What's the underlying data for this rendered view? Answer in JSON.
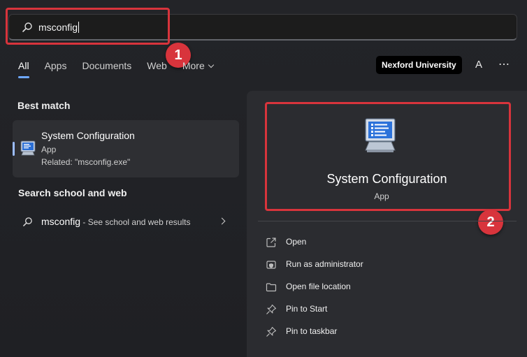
{
  "search": {
    "query": "msconfig"
  },
  "tabs": [
    {
      "label": "All"
    },
    {
      "label": "Apps"
    },
    {
      "label": "Documents"
    },
    {
      "label": "Web"
    },
    {
      "label": "More"
    }
  ],
  "header": {
    "org_label": "Nexford University",
    "avatar_letter": "A",
    "more_icon": "⋯"
  },
  "best_match": {
    "heading": "Best match",
    "name": "System Configuration",
    "type": "App",
    "related": "Related: \"msconfig.exe\""
  },
  "web": {
    "heading": "Search school and web",
    "query": "msconfig",
    "suffix": " - See school and web results"
  },
  "details": {
    "name": "System Configuration",
    "type": "App",
    "actions": [
      {
        "label": "Open",
        "icon": "open-icon"
      },
      {
        "label": "Run as administrator",
        "icon": "shield-icon"
      },
      {
        "label": "Open file location",
        "icon": "folder-icon"
      },
      {
        "label": "Pin to Start",
        "icon": "pin-icon"
      },
      {
        "label": "Pin to taskbar",
        "icon": "pin-icon"
      }
    ]
  },
  "annotations": {
    "step1": "1",
    "step2": "2"
  },
  "colors": {
    "annotation": "#d8343c",
    "accent": "#6ea8ff",
    "background": "#202124"
  }
}
